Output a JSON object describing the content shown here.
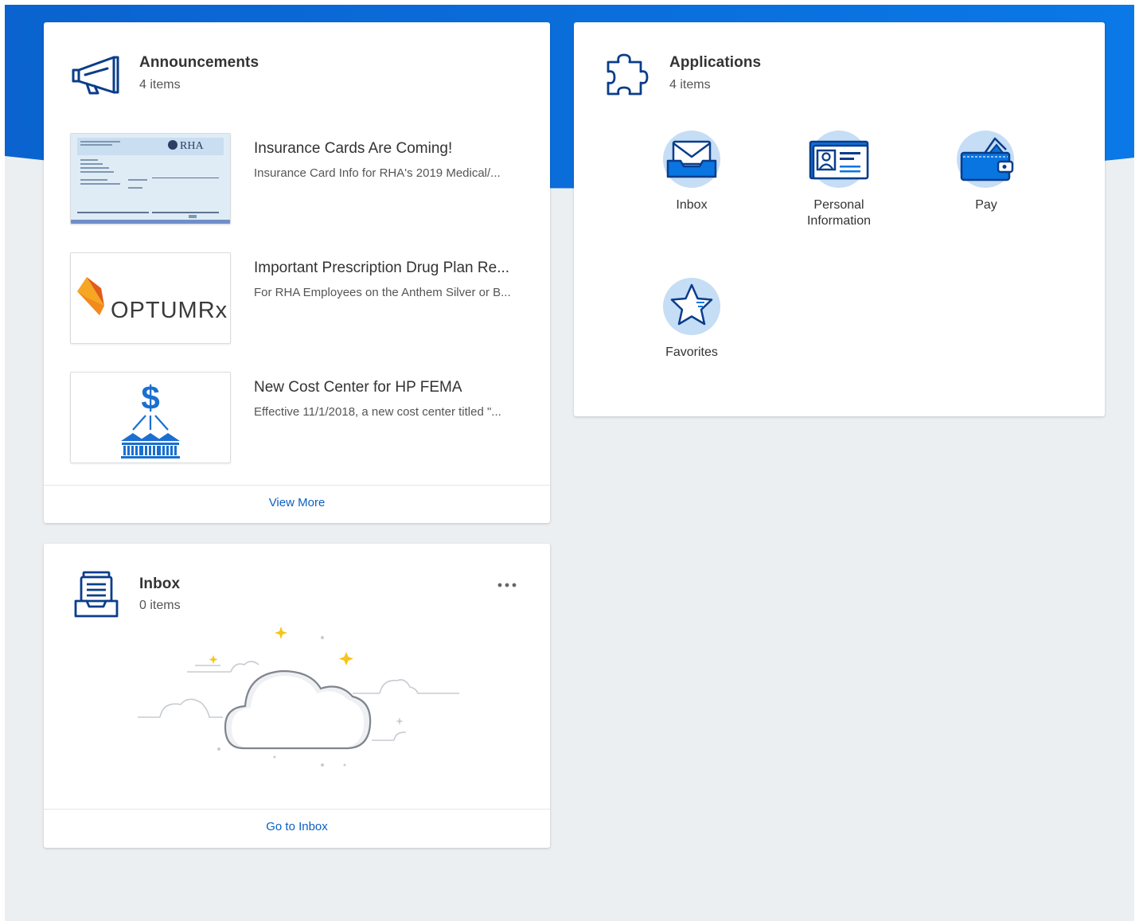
{
  "announcements": {
    "title": "Announcements",
    "count": "4 items",
    "items": [
      {
        "title": "Insurance Cards Are Coming!",
        "description": "Insurance Card Info for RHA's 2019 Medical/...",
        "thumb_text": "RHA"
      },
      {
        "title": "Important Prescription Drug Plan Re...",
        "description": "For RHA Employees on the Anthem Silver or B...",
        "thumb_text": "OPTUMRx"
      },
      {
        "title": "New Cost Center for HP FEMA",
        "description": "Effective 11/1/2018, a new cost center titled \"...",
        "thumb_text": "$"
      }
    ],
    "footer_link": "View More"
  },
  "applications": {
    "title": "Applications",
    "count": "4 items",
    "apps": [
      {
        "label": "Inbox",
        "icon": "inbox-app-icon"
      },
      {
        "label": "Personal Information",
        "icon": "personal-information-icon"
      },
      {
        "label": "Pay",
        "icon": "wallet-icon"
      },
      {
        "label": "Favorites",
        "icon": "star-icon"
      }
    ]
  },
  "inbox": {
    "title": "Inbox",
    "count": "0 items",
    "footer_link": "Go to Inbox",
    "empty_illustration": "cloud-illustration"
  },
  "colors": {
    "brand_blue": "#0875e1",
    "link_blue": "#0b5fc4",
    "icon_navy": "#0a3d8a",
    "icon_circle": "#c5ddf5",
    "page_background": "#eceff2"
  }
}
